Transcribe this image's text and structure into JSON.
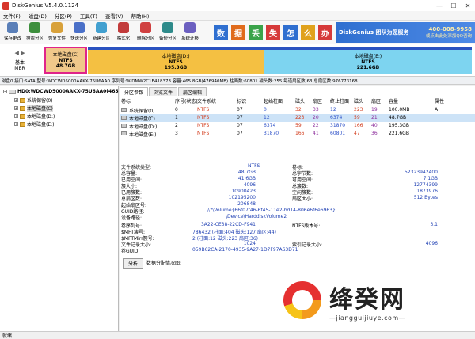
{
  "window": {
    "title": "DiskGenius V5.4.0.1124"
  },
  "menu": [
    "文件(F)",
    "磁盘(D)",
    "分区(P)",
    "工具(T)",
    "查看(V)",
    "帮助(H)"
  ],
  "toolbar": [
    {
      "label": "保存更改",
      "icon": "save-icon",
      "color": "#5a7fb8"
    },
    {
      "label": "搜索分区",
      "icon": "search-partition-icon",
      "color": "#3d8f3d"
    },
    {
      "label": "恢复文件",
      "icon": "restore-file-icon",
      "color": "#d8a13a"
    },
    {
      "label": "快速分区",
      "icon": "quick-partition-icon",
      "color": "#4a70c8"
    },
    {
      "label": "新建分区",
      "icon": "new-partition-icon",
      "color": "#42a0d0"
    },
    {
      "label": "格式化",
      "icon": "format-icon",
      "color": "#c23b3b"
    },
    {
      "label": "删除分区",
      "icon": "delete-partition-icon",
      "color": "#d04040"
    },
    {
      "label": "备份分区",
      "icon": "backup-partition-icon",
      "color": "#2e8a8a"
    },
    {
      "label": "系统迁移",
      "icon": "system-migrate-icon",
      "color": "#6b5fc0"
    }
  ],
  "banner": {
    "tiles": [
      {
        "char": "数",
        "color": "#2f6fd0"
      },
      {
        "char": "据",
        "color": "#e06b1c"
      },
      {
        "char": "丢",
        "color": "#3aa34a"
      },
      {
        "char": "失",
        "color": "#d63a3a"
      },
      {
        "char": "怎",
        "color": "#2f6fd0"
      },
      {
        "char": "么",
        "color": "#e0a21c"
      },
      {
        "char": "办",
        "color": "#d63a3a"
      }
    ],
    "slogan": "DiskGenius 团队为您服务",
    "phone": "400-008-9958",
    "qq": "或点击此处添加QQ咨询"
  },
  "diskmap": {
    "mbr_top": "基本",
    "mbr_bottom": "MBR",
    "partitions": [
      {
        "name": "本地磁盘(C)",
        "fs": "NTFS",
        "size": "48.7GB",
        "selected": true
      },
      {
        "name": "本地磁盘(D:)",
        "fs": "NTFS",
        "size": "195.3GB",
        "selected": false
      },
      {
        "name": "本地磁盘(E:)",
        "fs": "NTFS",
        "size": "221.6GB",
        "selected": false
      }
    ]
  },
  "diskinfo": "磁盘0 接口:SATA  型号:WDCWD5000AAKX-75U6AA0  序列号:W-DMW2C1E418373  容量:465.8GB(476940MB)  柱面数:60801  磁头数:255  每道扇区数:63  总扇区数:976773168",
  "tree": {
    "disk": "HD0:WDCWD5000AAKX-75U6AA0(465",
    "items": [
      "系统保留(0)",
      "本地磁盘(C)",
      "本地磁盘(D:)",
      "本地磁盘(E:)"
    ]
  },
  "tabs": [
    "分区参数",
    "浏览文件",
    "扇区编辑"
  ],
  "table": {
    "headers": [
      "卷标",
      "序号(状态)",
      "文件系统",
      "标识",
      "起始柱面",
      "磁头",
      "扇区",
      "终止柱面",
      "磁头",
      "扇区",
      "容量",
      "属性"
    ],
    "rows": [
      [
        "系统保留(0)",
        "0",
        "NTFS",
        "07",
        "0",
        "32",
        "33",
        "12",
        "223",
        "19",
        "100.0MB",
        "A"
      ],
      [
        "本地磁盘(C)",
        "1",
        "NTFS",
        "07",
        "12",
        "223",
        "20",
        "6374",
        "59",
        "21",
        "48.7GB",
        ""
      ],
      [
        "本地磁盘(D:)",
        "2",
        "NTFS",
        "07",
        "6374",
        "59",
        "22",
        "31870",
        "166",
        "40",
        "195.3GB",
        ""
      ],
      [
        "本地磁盘(E:)",
        "3",
        "NTFS",
        "07",
        "31870",
        "166",
        "41",
        "60801",
        "47",
        "36",
        "221.6GB",
        ""
      ]
    ]
  },
  "details": {
    "fs_type_label": "文件系统类型:",
    "fs_type": "NTFS",
    "vol_label_label": "卷标:",
    "rows1": [
      [
        "总容量:",
        "48.7GB",
        "总字节数:",
        "52323942400"
      ],
      [
        "已用空间:",
        "41.6GB",
        "可用空间:",
        "7.1GB"
      ],
      [
        "簇大小:",
        "4096",
        "总簇数:",
        "12774399"
      ],
      [
        "已用簇数:",
        "10900423",
        "空闲簇数:",
        "1873976"
      ],
      [
        "总扇区数:",
        "102195200",
        "扇区大小:",
        "512 Bytes"
      ],
      [
        "起始扇区号:",
        "206848",
        "",
        ""
      ]
    ],
    "guid_path_label": "GUID路径:",
    "guid_path": "\\\\?\\Volume{66f07f46-6f45-11e2-bd14-806e6f6e6963}",
    "device_path_label": "设备路径:",
    "device_path": "\\Device\\HarddiskVolume2",
    "rows2": [
      [
        "卷序列号:",
        "3A22-CE38-22CD-F941",
        "NTFS版本号:",
        "3.1"
      ],
      [
        "$MFT簇号:",
        "786432 (柱面:404 磁头:127 扇区:44)",
        "",
        ""
      ],
      [
        "$MFTMirr簇号:",
        "2 (柱面:12 磁头:223 扇区:36)",
        "",
        ""
      ],
      [
        "文件记录大小:",
        "1024",
        "索引记录大小:",
        "4096"
      ],
      [
        "卷GUID:",
        "059B62CA-2170-4935-9A27-1D7F97A63D71",
        "",
        ""
      ]
    ],
    "analyze_button": "分析",
    "alloc_label": "数据分配情况图:"
  },
  "status": "就绪",
  "watermark": {
    "brand": "绛癸网",
    "url": "—jiangguijiuye.com—"
  }
}
